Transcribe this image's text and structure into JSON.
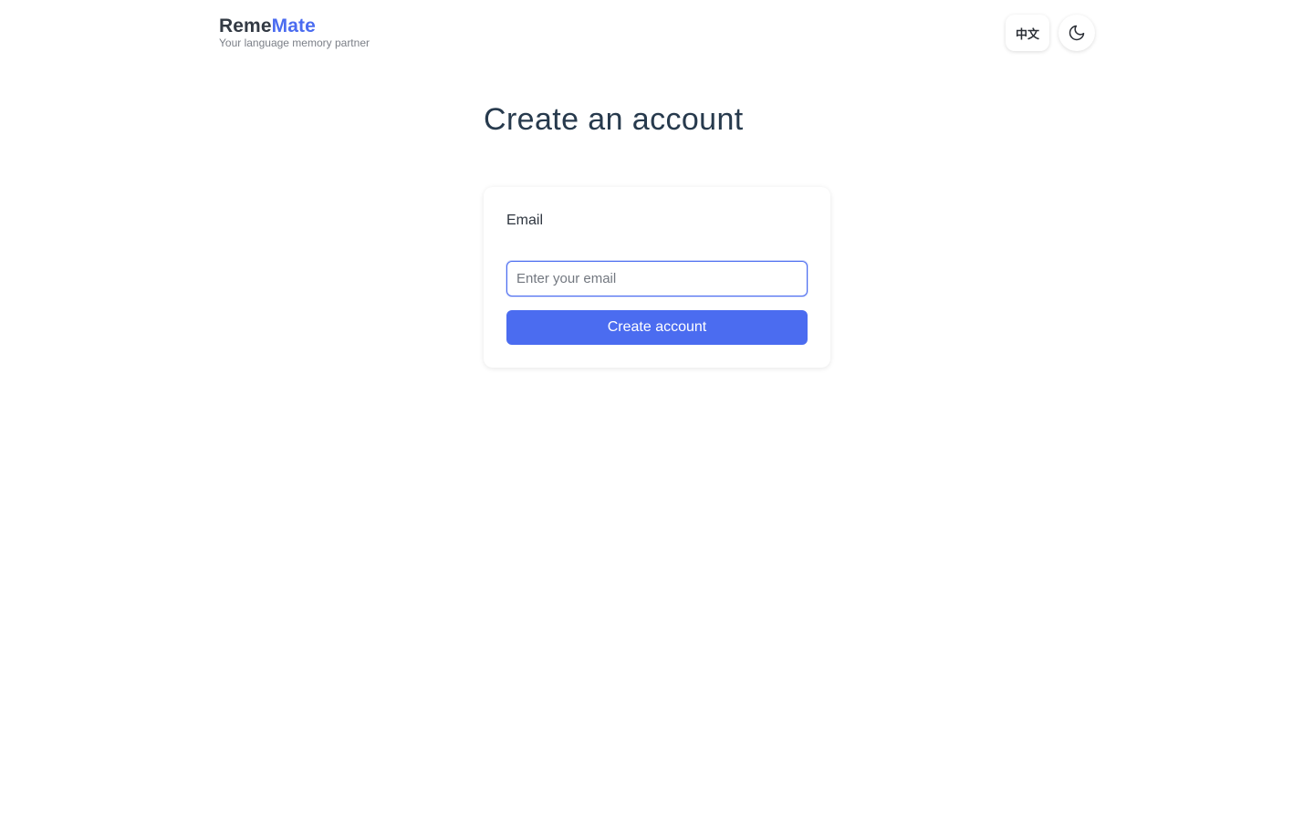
{
  "header": {
    "brand_part1": "Reme",
    "brand_part2": "Mate",
    "tagline": "Your language memory partner",
    "language_toggle_label": "中文",
    "theme_toggle_icon": "moon-icon"
  },
  "main": {
    "title": "Create an account",
    "form": {
      "email_label": "Email",
      "email_value": "",
      "email_placeholder": "Enter your email",
      "submit_label": "Create account"
    }
  },
  "colors": {
    "accent": "#4b6cf0",
    "title": "#273a4d",
    "text": "#2f3640",
    "muted": "#7b7f87"
  }
}
